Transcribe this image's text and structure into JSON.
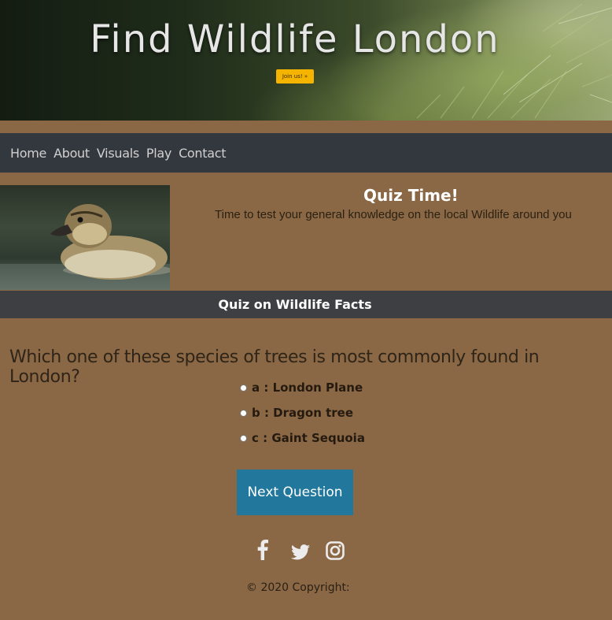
{
  "hero": {
    "title": "Find Wildlife London",
    "join_label": "Join us! »"
  },
  "nav": {
    "items": [
      {
        "label": "Home"
      },
      {
        "label": "About"
      },
      {
        "label": "Visuals"
      },
      {
        "label": "Play"
      },
      {
        "label": "Contact"
      }
    ]
  },
  "intro": {
    "title": "Quiz Time!",
    "subtitle": "Time to test your general knowledge on the local Wildlife around you",
    "image_icon": "duckling-photo"
  },
  "quiz": {
    "header": "Quiz on Wildlife Facts",
    "question": "Which one of these species of trees is most commonly found in London?",
    "options": [
      {
        "label": "a : London Plane"
      },
      {
        "label": "b : Dragon tree"
      },
      {
        "label": "c : Gaint Sequoia"
      }
    ],
    "next_label": "Next Question"
  },
  "footer": {
    "social_icons": [
      "facebook-icon",
      "twitter-icon",
      "instagram-icon"
    ],
    "copyright": "© 2020 Copyright:"
  },
  "colors": {
    "page_bg": "#8b6845",
    "nav_bg": "#33383e",
    "quiz_bar_bg": "#3d3f42",
    "button_bg": "#22789c",
    "join_button_bg": "#f5b400"
  }
}
